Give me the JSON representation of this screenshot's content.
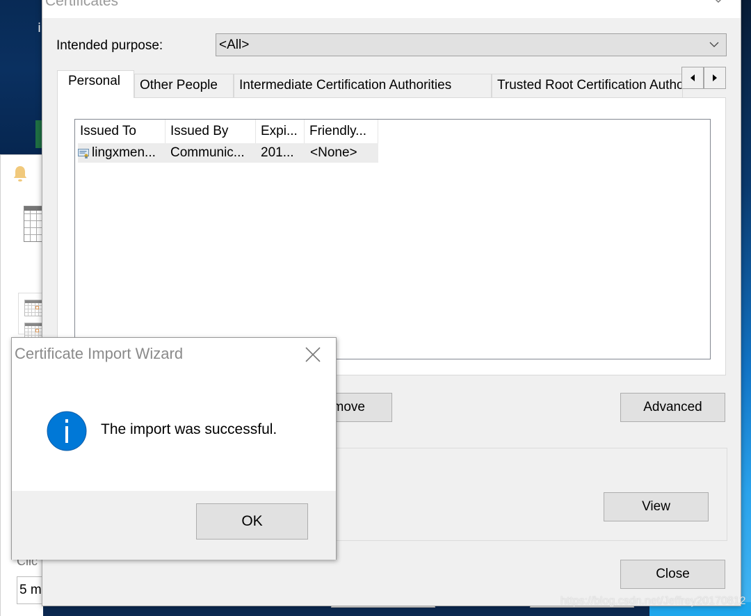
{
  "background_app": {
    "click_label": "Clic",
    "minutes_value": "5 m"
  },
  "certificates_dialog": {
    "title": "Certificates",
    "intended_purpose_label": "Intended purpose:",
    "intended_purpose_value": "<All>",
    "tabs": [
      {
        "label": "Personal",
        "active": true
      },
      {
        "label": "Other People",
        "active": false
      },
      {
        "label": "Intermediate Certification Authorities",
        "active": false
      },
      {
        "label": "Trusted Root Certification Authorities",
        "active": false
      }
    ],
    "list": {
      "columns": [
        "Issued To",
        "Issued By",
        "Expi...",
        "Friendly..."
      ],
      "rows": [
        {
          "issued_to": "lingxmen...",
          "issued_by": "Communic...",
          "expiration": "201...",
          "friendly_name": "<None>",
          "icon": "certificate-icon"
        }
      ]
    },
    "buttons": {
      "remove": "Remove",
      "advanced": "Advanced",
      "view": "View",
      "close": "Close"
    }
  },
  "import_wizard": {
    "title": "Certificate Import Wizard",
    "icon": "info-icon",
    "message": "The import was successful.",
    "ok_label": "OK"
  },
  "watermark": "https://blog.csdn.net/Jeffrey20170812",
  "colors": {
    "info_blue": "#0078d7",
    "dialog_bg": "#f0f0f0",
    "button_bg": "#e1e1e1"
  }
}
